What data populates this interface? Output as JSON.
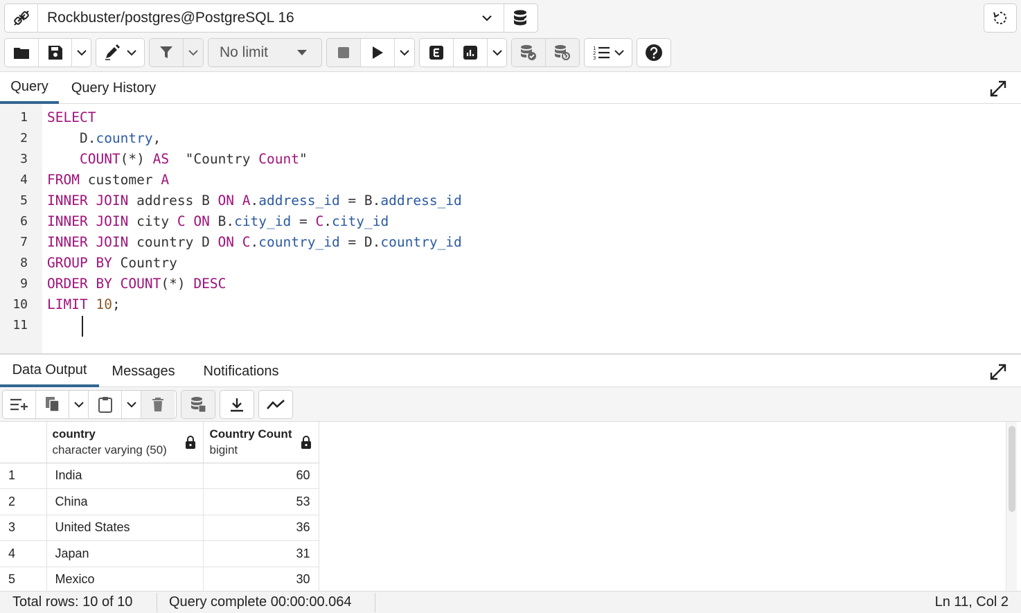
{
  "connection": {
    "label": "Rockbuster/postgres@PostgreSQL 16"
  },
  "toolbar": {
    "limit_label": "No limit"
  },
  "editor_tabs": [
    "Query",
    "Query History"
  ],
  "editor": {
    "line_numbers": [
      "1",
      "2",
      "3",
      "4",
      "5",
      "6",
      "7",
      "8",
      "9",
      "10",
      "11"
    ],
    "code": [
      [
        [
          "kw",
          "SELECT"
        ]
      ],
      [
        [
          "",
          "    D."
        ],
        [
          "fld",
          "country"
        ],
        [
          "",
          ","
        ]
      ],
      [
        [
          "",
          "    "
        ],
        [
          "kw",
          "COUNT"
        ],
        [
          "",
          "(*) "
        ],
        [
          "kw",
          "AS"
        ],
        [
          "",
          "  \"Country "
        ],
        [
          "kw",
          "Count"
        ],
        [
          "",
          "\""
        ]
      ],
      [
        [
          "kw",
          "FROM"
        ],
        [
          "",
          " customer "
        ],
        [
          "kw",
          "A"
        ]
      ],
      [
        [
          "kw",
          "INNER JOIN"
        ],
        [
          "",
          " address B "
        ],
        [
          "kw",
          "ON"
        ],
        [
          "",
          " "
        ],
        [
          "kw",
          "A"
        ],
        [
          "",
          "."
        ],
        [
          "fld",
          "address_id"
        ],
        [
          "",
          " = B."
        ],
        [
          "fld",
          "address_id"
        ]
      ],
      [
        [
          "kw",
          "INNER JOIN"
        ],
        [
          "",
          " city "
        ],
        [
          "kw",
          "C"
        ],
        [
          "",
          " "
        ],
        [
          "kw",
          "ON"
        ],
        [
          "",
          " B."
        ],
        [
          "fld",
          "city_id"
        ],
        [
          "",
          " = "
        ],
        [
          "kw",
          "C"
        ],
        [
          "",
          "."
        ],
        [
          "fld",
          "city_id"
        ]
      ],
      [
        [
          "kw",
          "INNER JOIN"
        ],
        [
          "",
          " country D "
        ],
        [
          "kw",
          "ON"
        ],
        [
          "",
          " "
        ],
        [
          "kw",
          "C"
        ],
        [
          "",
          "."
        ],
        [
          "fld",
          "country_id"
        ],
        [
          "",
          " = D."
        ],
        [
          "fld",
          "country_id"
        ]
      ],
      [
        [
          "kw",
          "GROUP BY"
        ],
        [
          "",
          " Country"
        ]
      ],
      [
        [
          "kw",
          "ORDER BY"
        ],
        [
          "",
          " "
        ],
        [
          "kw",
          "COUNT"
        ],
        [
          "",
          "(*) "
        ],
        [
          "kw",
          "DESC"
        ]
      ],
      [
        [
          "kw",
          "LIMIT"
        ],
        [
          "",
          " "
        ],
        [
          "num",
          "10"
        ],
        [
          "",
          ";"
        ]
      ],
      [
        [
          "",
          ""
        ]
      ]
    ]
  },
  "result_tabs": [
    "Data Output",
    "Messages",
    "Notifications"
  ],
  "grid": {
    "columns": [
      {
        "name": "country",
        "type": "character varying (50)"
      },
      {
        "name": "Country Count",
        "type": "bigint"
      }
    ],
    "rows": [
      {
        "n": "1",
        "country": "India",
        "count": "60"
      },
      {
        "n": "2",
        "country": "China",
        "count": "53"
      },
      {
        "n": "3",
        "country": "United States",
        "count": "36"
      },
      {
        "n": "4",
        "country": "Japan",
        "count": "31"
      },
      {
        "n": "5",
        "country": "Mexico",
        "count": "30"
      }
    ]
  },
  "status": {
    "total_rows": "Total rows: 10 of 10",
    "query_complete": "Query complete 00:00:00.064",
    "cursor": "Ln 11, Col 2"
  },
  "colors": {
    "accent": "#326690",
    "keyword": "#a0127a",
    "field": "#2b5aa3",
    "number": "#8a5a2b"
  }
}
